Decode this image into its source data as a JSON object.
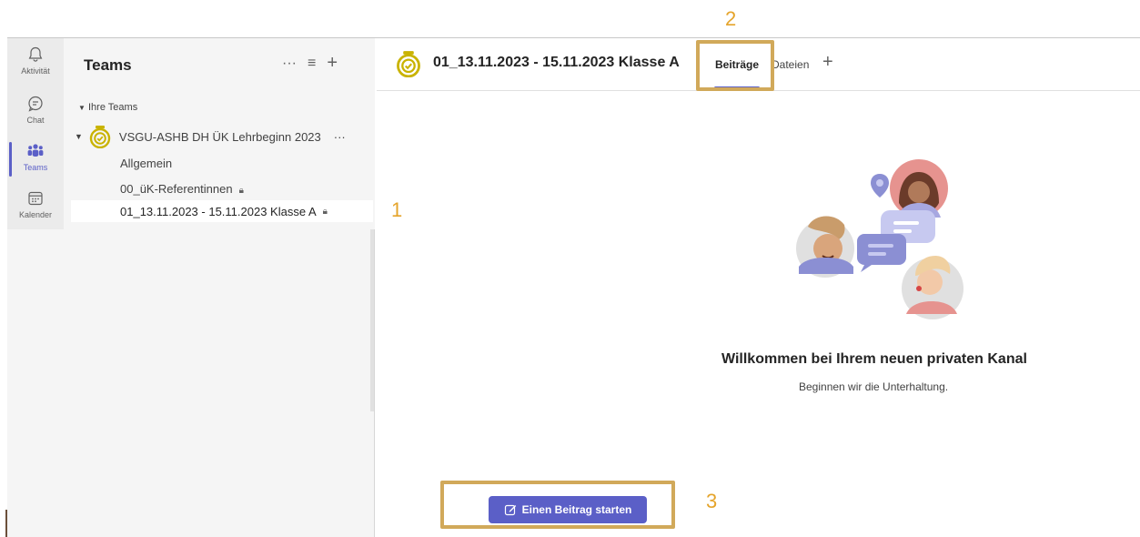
{
  "rail": {
    "items": [
      {
        "label": "Aktivität",
        "icon": "bell-icon"
      },
      {
        "label": "Chat",
        "icon": "chat-icon"
      },
      {
        "label": "Teams",
        "icon": "teams-icon",
        "active": true
      },
      {
        "label": "Kalender",
        "icon": "calendar-icon"
      }
    ]
  },
  "sidebar": {
    "title": "Teams",
    "more_label": "···",
    "filter_label": "≡",
    "add_label": "+",
    "your_teams_label": "Ihre Teams",
    "team_name": "VSGU-ASHB DH ÜK Lehrbeginn 2023",
    "team_more_label": "···",
    "channels": [
      {
        "label": "Allgemein",
        "private": false
      },
      {
        "label": "00_üK-Referentinnen",
        "private": true
      },
      {
        "label": "01_13.11.2023 - 15.11.2023 Klasse A",
        "private": true,
        "selected": true
      }
    ]
  },
  "header": {
    "channel_title": "01_13.11.2023 - 15.11.2023 Klasse A",
    "tabs": [
      {
        "label": "Beiträge",
        "active": true
      },
      {
        "label": "Dateien",
        "active": false
      }
    ],
    "add_tab_label": "+"
  },
  "annotations": [
    "1",
    "2",
    "3"
  ],
  "welcome": {
    "title": "Willkommen bei Ihrem neuen privaten Kanal",
    "subtitle": "Beginnen wir die Unterhaltung."
  },
  "compose": {
    "button_label": "Einen Beitrag starten"
  },
  "colors": {
    "accent": "#5b5fc7",
    "annotation": "#d1a95a",
    "annotation_number": "#e5a42b",
    "team_logo": "#c9b300"
  }
}
